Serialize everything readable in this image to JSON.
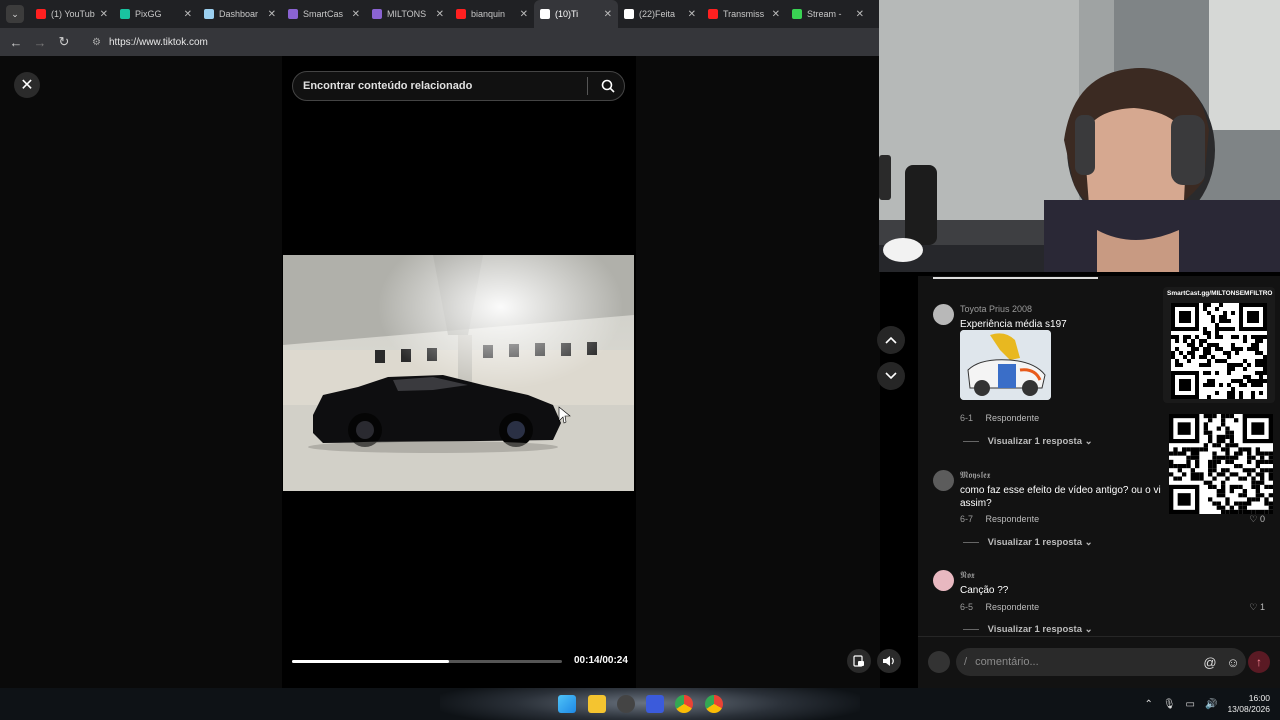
{
  "browser": {
    "tabs": [
      {
        "label": "(1) YouTub",
        "color": "#ff2020"
      },
      {
        "label": "PixGG",
        "color": "#19c3a0"
      },
      {
        "label": "Dashboar",
        "color": "#9bd0f0"
      },
      {
        "label": "SmartCas",
        "color": "#8a63d2"
      },
      {
        "label": "MILTONS",
        "color": "#8a63d2"
      },
      {
        "label": "bianquin",
        "color": "#ff2020"
      },
      {
        "label": "(10)Ti",
        "color": "#ffffff"
      },
      {
        "label": "(22)Feita",
        "color": "#ffffff"
      },
      {
        "label": "Transmiss",
        "color": "#ff2020"
      },
      {
        "label": "Stream - ",
        "color": "#39d353"
      }
    ],
    "url": "https://www.tiktok.com"
  },
  "search": {
    "placeholder": "Encontrar conteúdo relacionado"
  },
  "player": {
    "time": "00:14/00:24",
    "progress_fraction": 0.583
  },
  "comments": [
    {
      "user": "Toyota Prius 2008",
      "text": "Experiência média s197",
      "date": "6-1",
      "reply": "Respondente",
      "view_replies": "Visualizar 1 resposta",
      "likes": ""
    },
    {
      "user": "𝕸𝖔𝖞𝖘𝖑𝖊𝖝",
      "text": "como faz esse efeito de vídeo antigo? ou o vi assim?",
      "date": "6-7",
      "reply": "Respondente",
      "view_replies": "Visualizar 1 resposta",
      "likes": "0"
    },
    {
      "user": "𝕹𝖔𝖝",
      "text": "Canção ??",
      "date": "6-5",
      "reply": "Respondente",
      "view_replies": "Visualizar 1 resposta",
      "likes": "1"
    }
  ],
  "comment_input": {
    "slash": "/",
    "placeholder": "comentário..."
  },
  "overlay": {
    "qr_label": "SmartCast.gg/MILTONSEMFILTRO"
  },
  "taskbar": {
    "time": "16:00",
    "date": "13/08/2026"
  }
}
